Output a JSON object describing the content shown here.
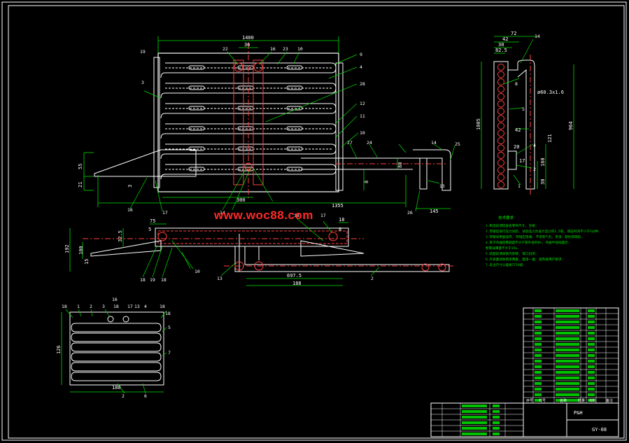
{
  "drawing": {
    "watermark": "www.woc88.com",
    "front_view": {
      "dims": {
        "width": "1400",
        "d36": "36",
        "d55": "55",
        "d21": "21",
        "d300": "300",
        "d1355": "1355",
        "d145": "145",
        "d8": "8",
        "d88": "88",
        "d3": "3"
      },
      "callouts": [
        "22",
        "16",
        "23",
        "10",
        "9",
        "4",
        "28",
        "12",
        "11",
        "10",
        "27",
        "24",
        "14",
        "25",
        "16",
        "3",
        "17",
        "14",
        "26",
        "13",
        "19"
      ]
    },
    "side_view": {
      "dims": {
        "d72": "72",
        "d42": "42",
        "d30": "30",
        "d82_5": "82.5",
        "pipe": "ø60.3x1.6",
        "d1005": "1005",
        "d964": "964",
        "d121": "121",
        "d160": "160",
        "d30b": "30",
        "d20": "20",
        "d42b": "42",
        "d17": "17"
      },
      "callouts": [
        "14",
        "8",
        "5",
        "4",
        "2",
        "1"
      ]
    },
    "top_view": {
      "dims": {
        "d75": "75",
        "d192": "192",
        "d100": "100",
        "d15": "15",
        "d32_5": "32.5",
        "d697_5": "697.5",
        "d188": "188",
        "d18": "18",
        "d8": "8",
        "d5": "5"
      },
      "callouts": [
        "18",
        "17",
        "18",
        "19",
        "18",
        "10",
        "13",
        "2"
      ]
    },
    "section_view": {
      "dims": {
        "d126": "126",
        "d180": "180"
      },
      "callouts": [
        "18",
        "1",
        "2",
        "3",
        "16",
        "18",
        "17",
        "13",
        "4",
        "18",
        "18",
        "5",
        "7",
        "2",
        "6"
      ]
    },
    "tech_notes": {
      "title": "技术要求",
      "lines": [
        "1.制造前须检查各零件尺寸, 合格.",
        "2.焊接后进行压力试验, 试验压力为设计压力的1.5倍, 保压时间不少于5分钟.",
        "3.焊接采用氩弧焊, 焊缝应饱满, 不得有气孔、夹渣、裂纹等缺陷.",
        "4.管子弯曲后椭圆度不大于管外径的8%, 弯曲半径按图示.",
        "  壁厚减薄量不大于15%.",
        "5.装配前清除管内杂物, 管口封闭.",
        "6.外表面涂防锈漆两遍, 面漆一遍, 颜色按用户要求.",
        "7.未注尺寸公差按IT14级."
      ]
    },
    "title_block": {
      "drawing_name": "P&H",
      "code": "GY-08",
      "header": [
        "序号",
        "代号",
        "名称",
        "数量",
        "材料",
        "备注"
      ],
      "rows": 17
    }
  }
}
